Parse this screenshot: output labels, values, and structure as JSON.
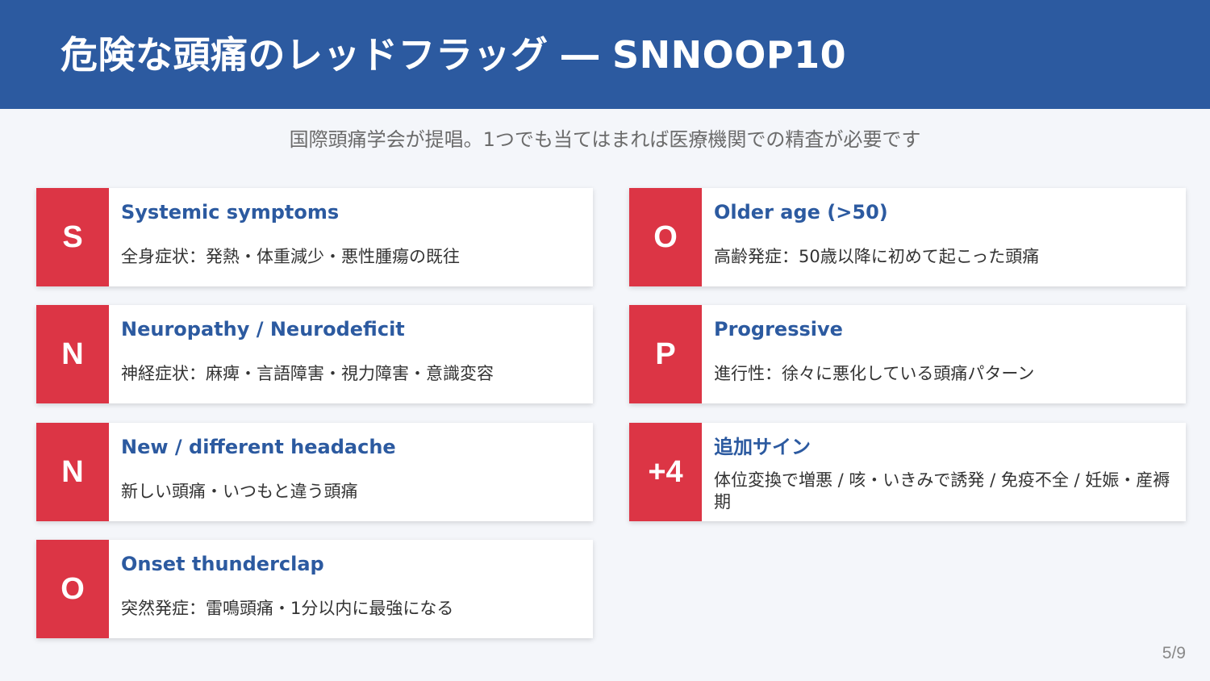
{
  "slide": {
    "title": "危険な頭痛のレッドフラッグ ― SNNOOP10",
    "subtitle": "国際頭痛学会が提唱。1つでも当てはまれば医療機関での精査が必要です",
    "page_number": "5/9"
  },
  "colors": {
    "header": "#2c5aa0",
    "badge": "#dc3545",
    "card_title": "#2c5aa0",
    "background": "#f4f6fa"
  },
  "left_cards": [
    {
      "letter": "S",
      "title": "Systemic symptoms",
      "desc": "全身症状：発熱・体重減少・悪性腫瘍の既往"
    },
    {
      "letter": "N",
      "title": "Neuropathy / Neurodeficit",
      "desc": "神経症状：麻痺・言語障害・視力障害・意識変容"
    },
    {
      "letter": "N",
      "title": "New / different headache",
      "desc": "新しい頭痛・いつもと違う頭痛"
    },
    {
      "letter": "O",
      "title": "Onset thunderclap",
      "desc": "突然発症：雷鳴頭痛・1分以内に最強になる"
    }
  ],
  "right_cards": [
    {
      "letter": "O",
      "title": "Older age (>50)",
      "desc": "高齢発症：50歳以降に初めて起こった頭痛"
    },
    {
      "letter": "P",
      "title": "Progressive",
      "desc": "進行性：徐々に悪化している頭痛パターン"
    },
    {
      "letter": "+4",
      "title": "追加サイン",
      "desc": "体位変換で増悪 / 咳・いきみで誘発 / 免疫不全 / 妊娠・産褥期"
    }
  ]
}
